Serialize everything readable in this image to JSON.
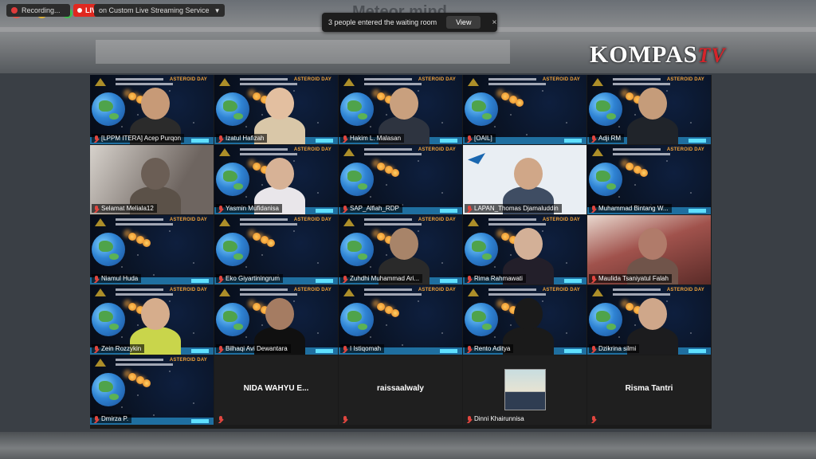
{
  "broadcast": {
    "watermark_title": "Meteor mind",
    "brand_main": "KOMPAS",
    "brand_tv": "TV"
  },
  "toolbar": {
    "recording_label": "Recording...",
    "live_label": "LIVE",
    "stream_label": "on Custom Live Streaming Service"
  },
  "notification": {
    "message": "3 people entered the waiting room",
    "view_label": "View",
    "close_glyph": "×"
  },
  "tile_banner": {
    "event_logo": "ASTEROID DAY"
  },
  "participants": [
    {
      "name": "[LPPM ITERA] Acep Purqon",
      "mic": "muted",
      "type": "video",
      "active": true
    },
    {
      "name": "Izatul Hafizah",
      "mic": "muted",
      "type": "video"
    },
    {
      "name": "Hakim L. Malasan",
      "mic": "muted",
      "type": "video"
    },
    {
      "name": "[OAIL]",
      "mic": "muted",
      "type": "video"
    },
    {
      "name": "Adji RM",
      "mic": "muted",
      "type": "video"
    },
    {
      "name": "Selamat Meliala12",
      "mic": "muted",
      "type": "video"
    },
    {
      "name": "Yasmin Mufidanisa",
      "mic": "muted",
      "type": "video"
    },
    {
      "name": "SAP_Alfiah_RDP",
      "mic": "muted",
      "type": "video"
    },
    {
      "name": "LAPAN_Thomas Djamaluddin",
      "mic": "muted",
      "type": "video"
    },
    {
      "name": "Muhammad Bintang W...",
      "mic": "muted",
      "type": "video"
    },
    {
      "name": "Niamul Huda",
      "mic": "muted",
      "type": "video"
    },
    {
      "name": "Eko Giyartiningrum",
      "mic": "muted",
      "type": "video"
    },
    {
      "name": "Zuhdhi Muhammad Ari...",
      "mic": "muted",
      "type": "video"
    },
    {
      "name": "Rima Rahmawati",
      "mic": "muted",
      "type": "video"
    },
    {
      "name": "Maulida Tsaniyatul Falah",
      "mic": "muted",
      "type": "video"
    },
    {
      "name": "Zein Rozzykin",
      "mic": "muted",
      "type": "video"
    },
    {
      "name": "Bilhaqi Avi Dewantara",
      "mic": "muted",
      "type": "video"
    },
    {
      "name": "I Istiqomah",
      "mic": "muted",
      "type": "video"
    },
    {
      "name": "Rento Aditya",
      "mic": "muted",
      "type": "video"
    },
    {
      "name": "Dzikrina silmi",
      "mic": "muted",
      "type": "video"
    },
    {
      "name": "Dmirza P.",
      "mic": "muted",
      "type": "video"
    },
    {
      "name": "NIDA WAHYU E...",
      "mic": "muted",
      "type": "name-only"
    },
    {
      "name": "raissaalwaly",
      "mic": "muted",
      "type": "name-only"
    },
    {
      "name": "Dinni Khairunnisa",
      "mic": "muted",
      "type": "avatar"
    },
    {
      "name": "Risma Tantri",
      "mic": "muted",
      "type": "name-only"
    }
  ],
  "colors": {
    "live_red": "#e0281f",
    "active_speaker": "#d8d24a",
    "muted_mic": "#e0463f"
  }
}
